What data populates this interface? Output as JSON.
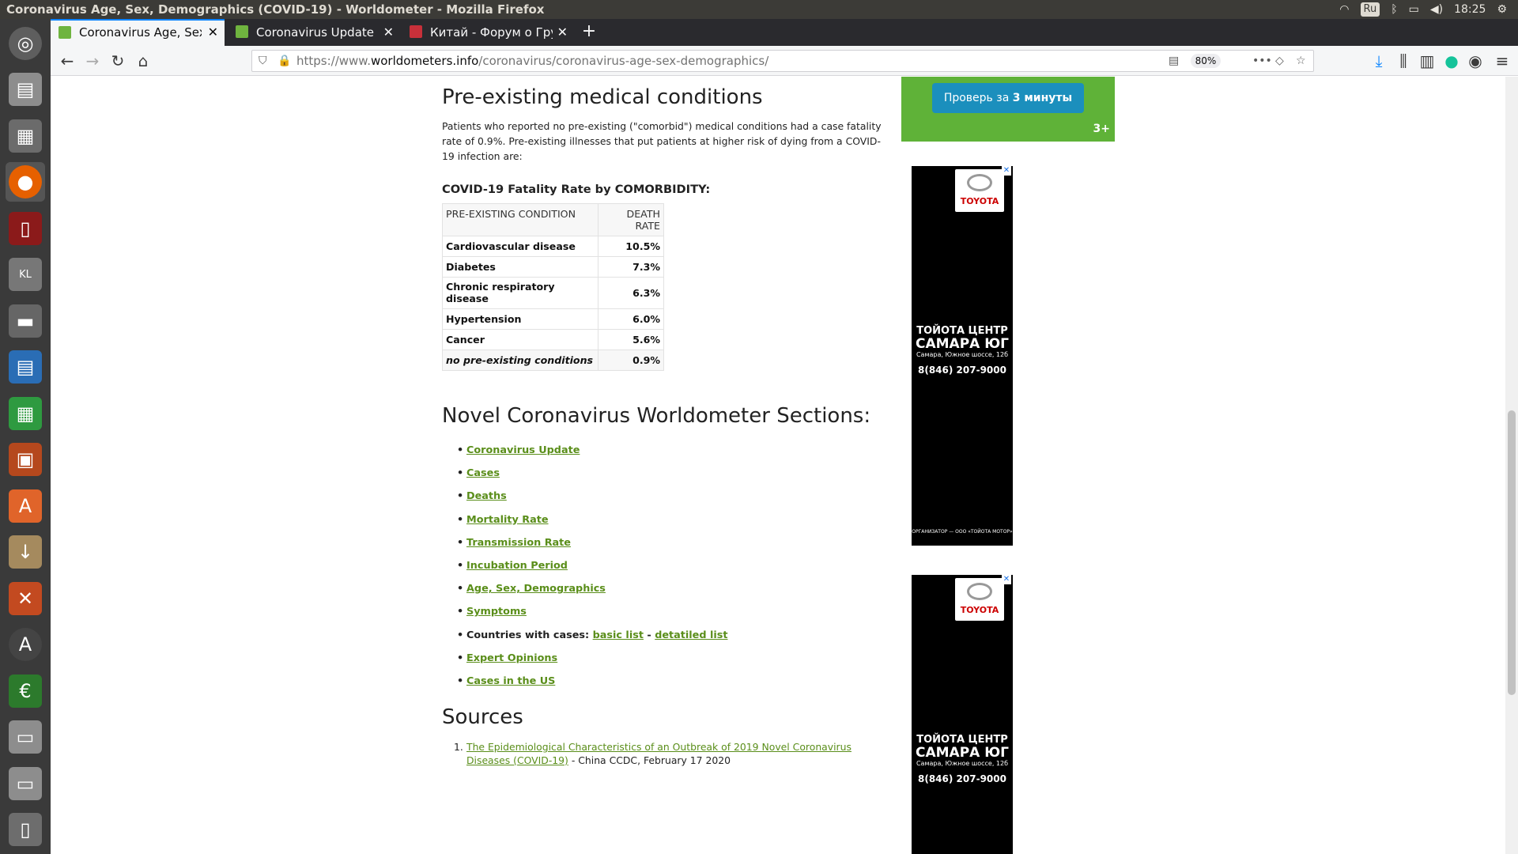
{
  "window": {
    "title": "Coronavirus Age, Sex, Demographics (COVID-19) - Worldometer - Mozilla Firefox",
    "keyboard_layout": "Ru",
    "clock": "18:25"
  },
  "tabs": [
    {
      "label": "Coronavirus Age, Sex, De",
      "favicon_color": "#6fb43f",
      "active": true
    },
    {
      "label": "Coronavirus Update (Liv",
      "favicon_color": "#6fb43f",
      "active": false
    },
    {
      "label": "Китай - Форум о Грузии",
      "favicon_color": "#c8303a",
      "active": false
    }
  ],
  "navbar": {
    "url_prefix": "https://www.",
    "url_domain": "worldometers.info",
    "url_path": "/coronavirus/coronavirus-age-sex-demographics/",
    "zoom": "80%"
  },
  "content": {
    "comorbidity_heading": "Pre-existing medical conditions",
    "comorbidity_text": "Patients who reported no pre-existing (\"comorbid\") medical conditions had a case fatality rate of 0.9%. Pre-existing illnesses that put patients at higher risk of dying from a COVID-19 infection are:",
    "table_caption": "COVID-19 Fatality Rate by COMORBIDITY:",
    "table_headers": {
      "condition": "PRE-EXISTING CONDITION",
      "rate_line1": "DEATH",
      "rate_line2": "RATE"
    },
    "table_rows": [
      {
        "condition": "Cardiovascular disease",
        "rate": "10.5%"
      },
      {
        "condition": "Diabetes",
        "rate": "7.3%"
      },
      {
        "condition": "Chronic respiratory disease",
        "rate": "6.3%"
      },
      {
        "condition": "Hypertension",
        "rate": "6.0%"
      },
      {
        "condition": "Cancer",
        "rate": "5.6%"
      },
      {
        "condition": "no pre-existing conditions",
        "rate": "0.9%"
      }
    ],
    "sections_heading": "Novel Coronavirus Worldometer Sections:",
    "section_links": [
      "Coronavirus Update",
      "Cases",
      "Deaths",
      "Mortality Rate",
      "Transmission Rate",
      "Incubation Period",
      "Age, Sex, Demographics",
      "Symptoms"
    ],
    "countries_label": "Countries with cases:",
    "countries_basic": "basic list",
    "countries_sep": "-",
    "countries_detailed": "detatiled list",
    "section_links_after": [
      "Expert Opinions",
      "Cases in the US"
    ],
    "sources_heading": "Sources",
    "source_num": "1.",
    "source_link": "The Epidemiological Characteristics of an Outbreak of 2019 Novel Coronavirus Diseases (COVID-19)",
    "source_tail": " - China CCDC, February 17 2020"
  },
  "ads": {
    "top_button_prefix": "Проверь за ",
    "top_button_bold": "3 минуты",
    "top_age": "3+",
    "toyota_brand": "TOYOTA",
    "toyota_line1": "ТОЙОТА ЦЕНТР",
    "toyota_line2": "САМАРА ЮГ",
    "toyota_addr": "Самара, Южное шоссе, 12б",
    "toyota_phone": "8(846) 207-9000",
    "toyota_footer": "ОРГАНИЗАТОР — ООО «ТОЙОТА МОТОР»",
    "ad_close": "✕"
  },
  "colors": {
    "link_green": "#5a8e1a",
    "tab_accent": "#0a84ff"
  }
}
